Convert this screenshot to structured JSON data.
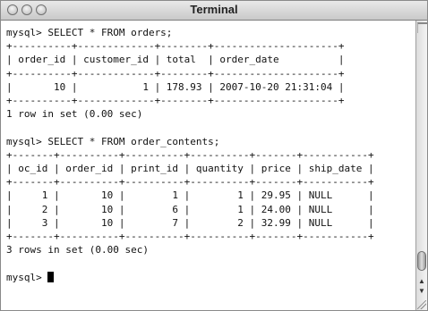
{
  "window": {
    "title": "Terminal"
  },
  "terminal": {
    "output": "mysql> SELECT * FROM orders;\n+----------+-------------+--------+---------------------+\n| order_id | customer_id | total  | order_date          |\n+----------+-------------+--------+---------------------+\n|       10 |           1 | 178.93 | 2007-10-20 21:31:04 |\n+----------+-------------+--------+---------------------+\n1 row in set (0.00 sec)\n\nmysql> SELECT * FROM order_contents;\n+-------+----------+----------+----------+-------+-----------+\n| oc_id | order_id | print_id | quantity | price | ship_date |\n+-------+----------+----------+----------+-------+-----------+\n|     1 |       10 |        1 |        1 | 29.95 | NULL      |\n|     2 |       10 |        6 |        1 | 24.00 | NULL      |\n|     3 |       10 |        7 |        2 | 32.99 | NULL      |\n+-------+----------+----------+----------+-------+-----------+\n3 rows in set (0.00 sec)\n\n",
    "prompt": "mysql> "
  }
}
